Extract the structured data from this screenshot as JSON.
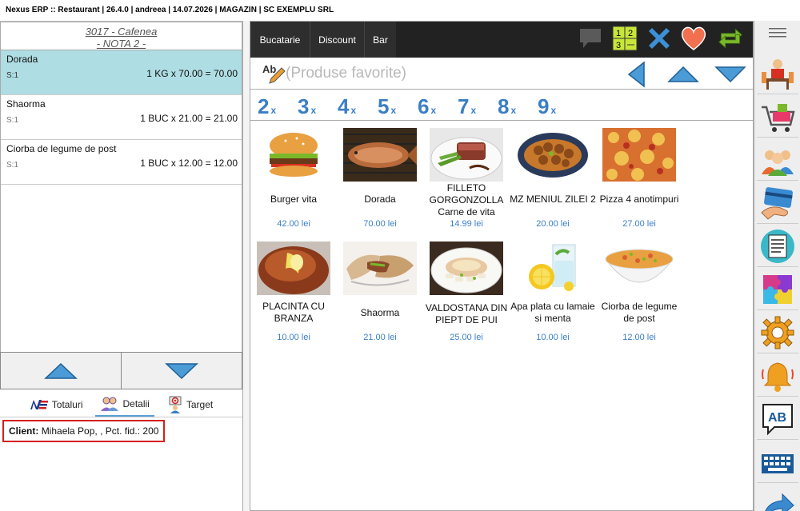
{
  "titlebar": {
    "text": "Nexus ERP :: Restaurant | 26.4.0 | andreea | 14.07.2026 | MAGAZIN | SC EXEMPLU SRL"
  },
  "order": {
    "header_line1": "3017 - Cafenea",
    "header_line2": "- NOTA 2 -",
    "items": [
      {
        "name": "Dorada",
        "seat": "S:1",
        "calc": "1 KG x 70.00 = 70.00",
        "selected": true
      },
      {
        "name": "Shaorma",
        "seat": "S:1",
        "calc": "1 BUC x 21.00 = 21.00",
        "selected": false
      },
      {
        "name": "Ciorba de legume de post",
        "seat": "S:1",
        "calc": "1 BUC x 12.00 = 12.00",
        "selected": false
      }
    ]
  },
  "tabs": [
    {
      "label": "Totaluri",
      "icon": "ne-logo-icon"
    },
    {
      "label": "Detalii",
      "icon": "people-icon",
      "active": true
    },
    {
      "label": "Target",
      "icon": "target-icon"
    }
  ],
  "client": {
    "label": "Client:",
    "value": "Mihaela Pop, , Pct. fid.: 200"
  },
  "categories": [
    "Bucatarie",
    "Discount",
    "Bar"
  ],
  "search": {
    "placeholder": "(Produse favorite)"
  },
  "quantities": [
    "2",
    "3",
    "4",
    "5",
    "6",
    "7",
    "8",
    "9"
  ],
  "qty_suffix": "x",
  "products": [
    {
      "name": "Burger vita",
      "price": "42.00 lei",
      "image": "burger"
    },
    {
      "name": "Dorada",
      "price": "70.00 lei",
      "image": "grilled-fish"
    },
    {
      "name": "FILLETO GORGONZOLLA Carne de vita",
      "price": "14.99 lei",
      "image": "beef-plate"
    },
    {
      "name": "MZ MENIUL ZILEI 2",
      "price": "20.00 lei",
      "image": "skewers"
    },
    {
      "name": "Pizza 4 anotimpuri",
      "price": "27.00 lei",
      "image": "pizza"
    },
    {
      "name": "PLACINTA CU BRANZA",
      "price": "10.00 lei",
      "image": "cheese-pie"
    },
    {
      "name": "Shaorma",
      "price": "21.00 lei",
      "image": "wrap"
    },
    {
      "name": "VALDOSTANA DIN PIEPT DE PUI",
      "price": "25.00 lei",
      "image": "chicken-plate"
    },
    {
      "name": "Apa plata cu lamaie si menta",
      "price": "10.00 lei",
      "image": "lemon-water"
    },
    {
      "name": "Ciorba de legume de post",
      "price": "12.00 lei",
      "image": "soup"
    }
  ],
  "colors": {
    "accent": "#3a7fc4",
    "selected_row": "#aedde3",
    "client_border": "#d32020",
    "topbar": "#222222"
  }
}
